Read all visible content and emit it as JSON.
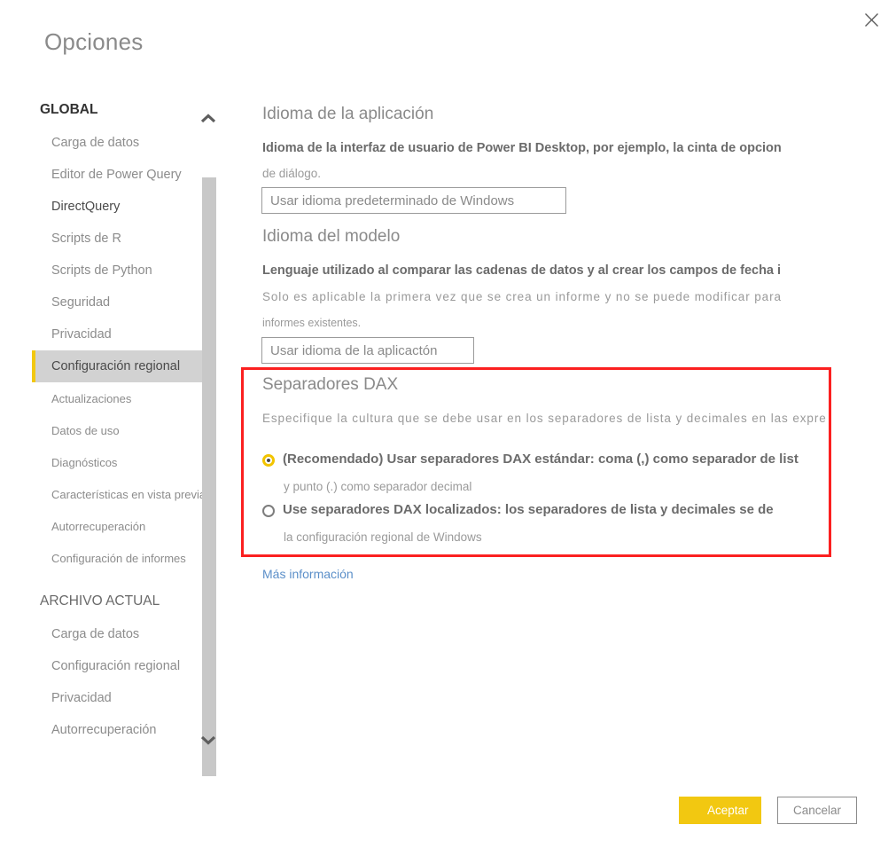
{
  "dialog": {
    "title": "Opciones",
    "close_icon": "close-icon"
  },
  "sidebar": {
    "groups": [
      {
        "header": "GLOBAL",
        "items": [
          {
            "label": "Carga de datos",
            "state": "normal"
          },
          {
            "label": "Editor de Power Query",
            "state": "normal"
          },
          {
            "label": "DirectQuery",
            "state": "strong"
          },
          {
            "label": "Scripts de R",
            "state": "normal"
          },
          {
            "label": "Scripts de Python",
            "state": "normal"
          },
          {
            "label": "Seguridad",
            "state": "normal"
          },
          {
            "label": "Privacidad",
            "state": "normal"
          },
          {
            "label": "Configuración regional",
            "state": "active"
          },
          {
            "label": "Actualizaciones",
            "state": "normal"
          },
          {
            "label": "Datos de uso",
            "state": "normal"
          },
          {
            "label": "Diagnósticos",
            "state": "normal"
          },
          {
            "label": "Características en vista previa",
            "state": "normal"
          },
          {
            "label": "Autorrecuperación",
            "state": "normal"
          },
          {
            "label": "Configuración de informes",
            "state": "normal"
          }
        ]
      },
      {
        "header": "ARCHIVO ACTUAL",
        "items": [
          {
            "label": "Carga de datos",
            "state": "normal"
          },
          {
            "label": "Configuración regional",
            "state": "normal"
          },
          {
            "label": "Privacidad",
            "state": "normal"
          },
          {
            "label": "Autorrecuperación",
            "state": "normal"
          }
        ]
      }
    ],
    "scroll_up_icon": "chevron-up-icon",
    "scroll_down_icon": "chevron-down-icon"
  },
  "main": {
    "app_language": {
      "title": "Idioma de la aplicación",
      "description_line1": "Idioma de la interfaz de usuario de Power BI Desktop, por ejemplo, la cinta de opcion",
      "description_line2": "de diálogo.",
      "dropdown_value": "Usar idioma predeterminado de Windows"
    },
    "model_language": {
      "title": "Idioma del modelo",
      "description_line1": "Lenguaje utilizado al comparar las cadenas de datos y al crear los campos de fecha i",
      "description_line2": "Solo es aplicable la primera vez que se crea un informe y no se puede modificar para",
      "description_line3": "informes existentes.",
      "dropdown_value": "Usar idioma de la aplicactón"
    },
    "dax_separators": {
      "title": "Separadores DAX",
      "description": "Especifique la cultura que se debe usar en los separadores de lista y decimales en las expre",
      "options": [
        {
          "label": "(Recomendado) Usar separadores DAX estándar: coma (,) como separador de list",
          "sub_label": "y punto (.) como separador decimal",
          "selected": true
        },
        {
          "label": "Use separadores DAX localizados: los separadores de lista y decimales se de",
          "sub_label": "la configuración regional de Windows",
          "selected": false
        }
      ],
      "highlight_color": "#fb2020"
    },
    "more_info_link": "Más información"
  },
  "footer": {
    "accept_label": "Aceptar",
    "cancel_label": "Cancelar",
    "accept_color": "#f2c811"
  }
}
